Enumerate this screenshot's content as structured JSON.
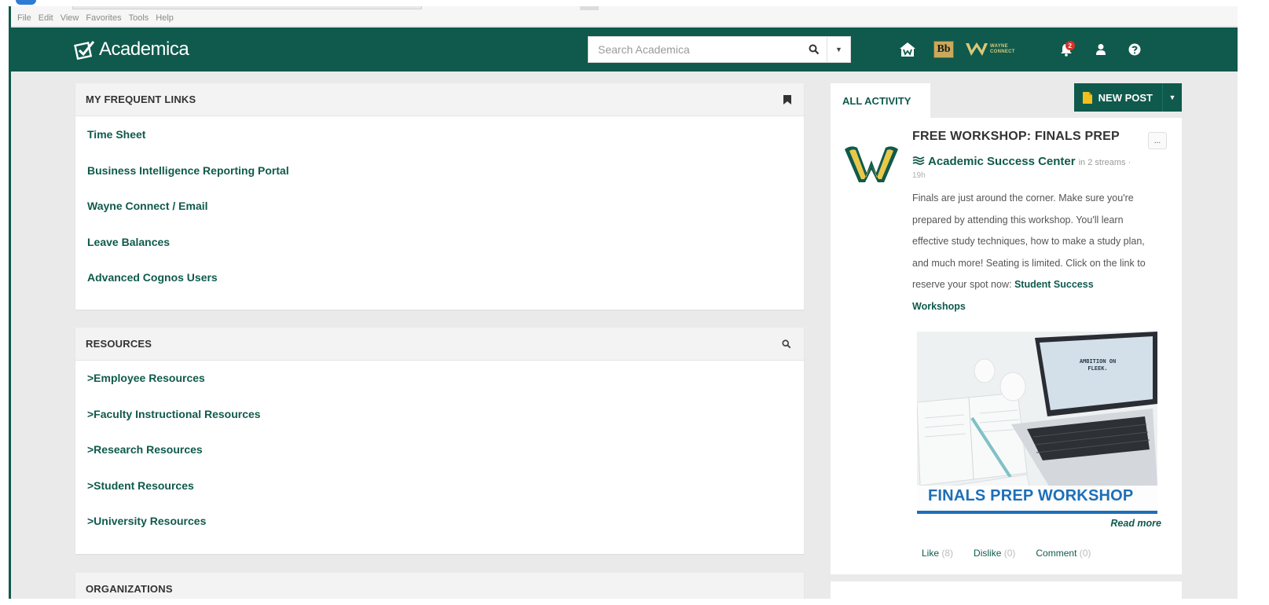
{
  "browser": {
    "menu": [
      "File",
      "Edit",
      "View",
      "Favorites",
      "Tools",
      "Help"
    ]
  },
  "header": {
    "logo_text": "Academica",
    "search_placeholder": "Search Academica",
    "bb_label": "Bb",
    "wayne_connect_line1": "WAYNE",
    "wayne_connect_line2": "CONNECT",
    "notification_count": "2"
  },
  "frequent_links": {
    "title": "MY FREQUENT LINKS",
    "items": [
      "Time Sheet",
      "Business Intelligence Reporting Portal",
      "Wayne Connect / Email",
      "Leave Balances",
      "Advanced Cognos Users"
    ]
  },
  "resources": {
    "title": "RESOURCES",
    "items": [
      ">Employee Resources",
      ">Faculty Instructional Resources",
      ">Research Resources",
      ">Student Resources",
      ">University Resources"
    ]
  },
  "organizations": {
    "title": "ORGANIZATIONS"
  },
  "activity": {
    "tab_label": "ALL ACTIVITY",
    "new_post_label": "NEW POST",
    "post": {
      "title": "FREE WORKSHOP: FINALS PREP",
      "more_label": "...",
      "source": "Academic Success Center",
      "streams": "in 2 streams ·",
      "time": "19h",
      "body": "Finals are just around the corner. Make sure you're prepared by attending this workshop. You'll learn effective study techniques, how to make a study plan, and much more! Seating is limited. Click on the link to reserve your spot now:",
      "link_text": "Student Success Workshops",
      "image_caption": "FINALS PREP WORKSHOP",
      "laptop_text": "AMBITION ON FLEEK.",
      "read_more": "Read more",
      "like_label": "Like",
      "like_count": "(8)",
      "dislike_label": "Dislike",
      "dislike_count": "(0)",
      "comment_label": "Comment",
      "comment_count": "(0)"
    }
  },
  "colors": {
    "brand_green": "#0f5a4c",
    "gold": "#c9a95c",
    "badge_red": "#d8332a"
  }
}
